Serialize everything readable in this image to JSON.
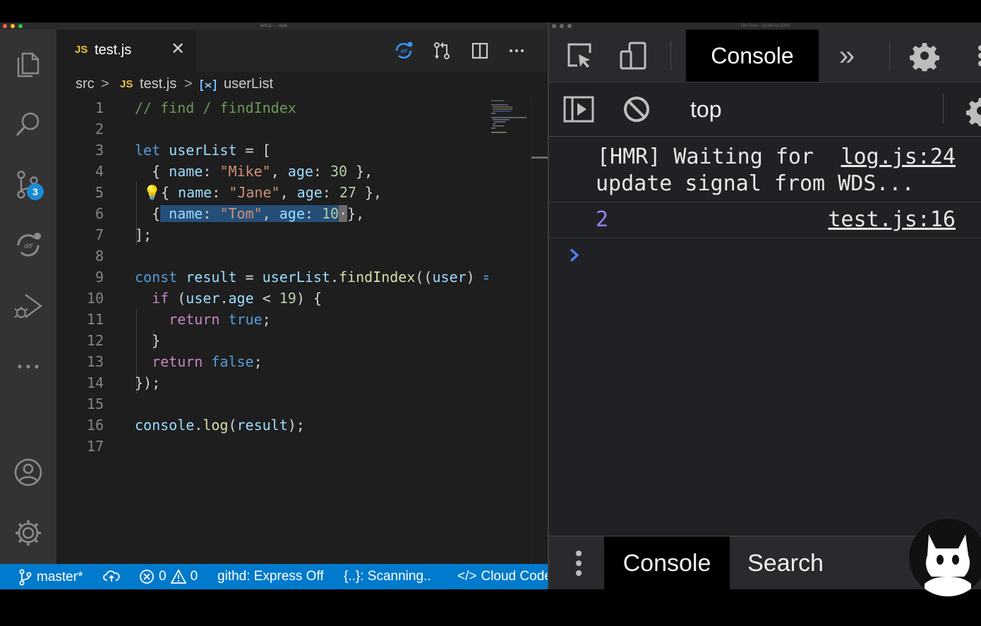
{
  "vscode": {
    "window_title": "test.js — code",
    "colors": {
      "statusbar": "#007acc",
      "activitybar": "#333333",
      "editor_bg": "#1e1e1e",
      "selection": "#264f78",
      "badge": "#1a8ad4"
    },
    "activity_bar": {
      "items": [
        {
          "name": "explorer",
          "icon": "files-icon"
        },
        {
          "name": "search",
          "icon": "search-icon"
        },
        {
          "name": "source-control",
          "icon": "source-control-icon",
          "badge": "3"
        },
        {
          "name": "diff",
          "icon": "diff-icon"
        },
        {
          "name": "run-debug",
          "icon": "run-debug-icon"
        },
        {
          "name": "more",
          "icon": "more-icon"
        }
      ],
      "bottom": [
        {
          "name": "accounts",
          "icon": "account-icon"
        },
        {
          "name": "manage",
          "icon": "gear-icon"
        }
      ]
    },
    "tab": {
      "lang_badge": "JS",
      "label": "test.js",
      "close": "✕"
    },
    "breadcrumb": {
      "folder": "src",
      "sep": ">",
      "file_badge": "JS",
      "file": "test.js",
      "symbol": "userList"
    },
    "editor": {
      "line_numbers": [
        "1",
        "2",
        "3",
        "4",
        "5",
        "6",
        "7",
        "8",
        "9",
        "10",
        "11",
        "12",
        "13",
        "14",
        "15",
        "16",
        "17"
      ],
      "selected_text": "name: \"Tom\", age: 10"
    },
    "statusbar": {
      "branch": "master*",
      "errors": "0",
      "warnings": "0",
      "githd": "githd: Express Off",
      "scanning": "{..}: Scanning..",
      "cloud_code": "Cloud Code"
    }
  },
  "devtools": {
    "window_title": "DevTools - localhost:3000/",
    "toolbar": {
      "tab_console": "Console",
      "more": "»"
    },
    "filter": {
      "context": "top"
    },
    "messages": [
      {
        "text_line1": "[HMR] Waiting for",
        "text_line2": "update signal from WDS...",
        "source": "log.js:24"
      },
      {
        "value": "2",
        "source": "test.js:16"
      }
    ],
    "prompt": "›",
    "drawer": {
      "tabs": [
        "Console",
        "Search"
      ]
    }
  }
}
